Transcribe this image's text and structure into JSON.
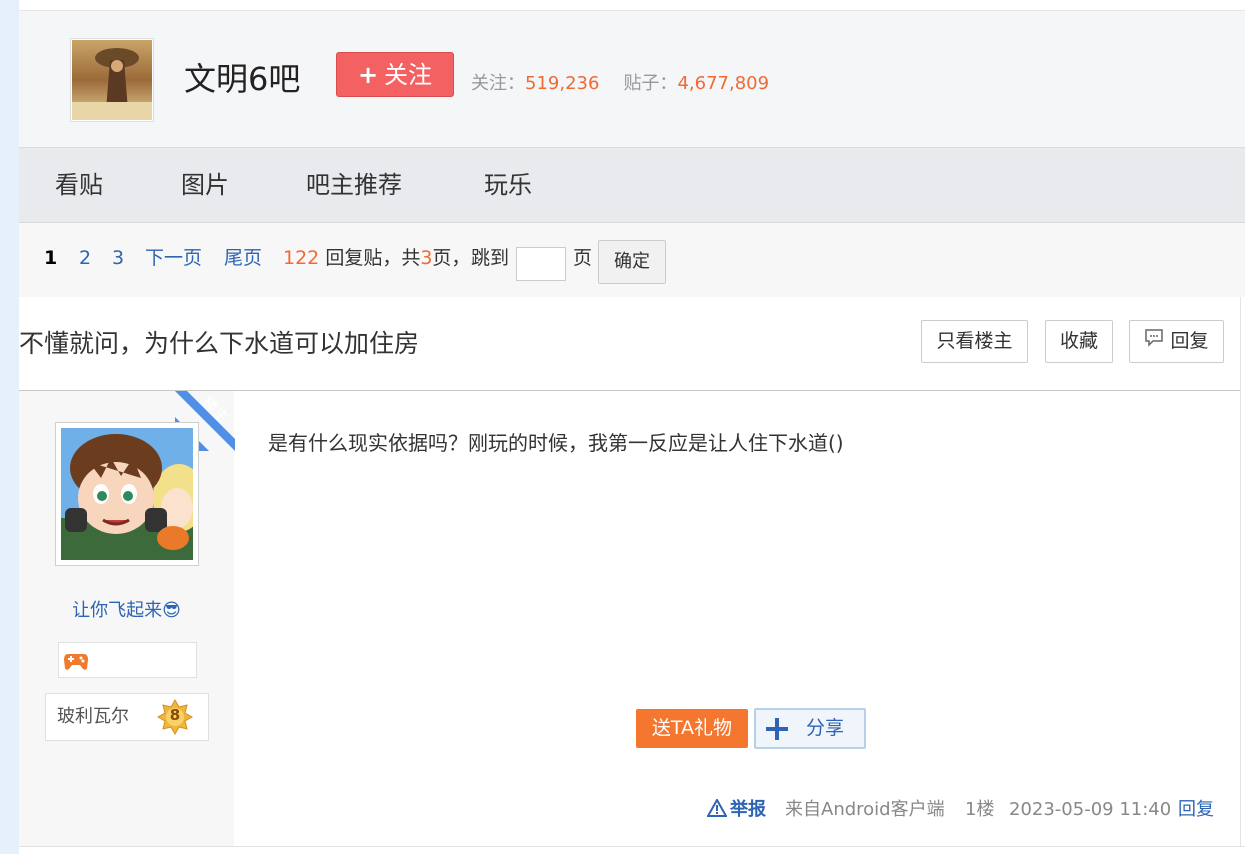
{
  "forum": {
    "name": "文明6吧",
    "follow_label": "关注",
    "follow_plus": "+",
    "followers_label": "关注：",
    "followers_count": "519,236",
    "posts_label": "贴子：",
    "posts_count": "4,677,809"
  },
  "nav": {
    "items": [
      "看贴",
      "图片",
      "吧主推荐",
      "玩乐"
    ]
  },
  "pager": {
    "current": "1",
    "pages": [
      "2",
      "3"
    ],
    "next": "下一页",
    "last": "尾页",
    "reply_count": "122",
    "reply_text": "回复贴，共",
    "total_pages": "3",
    "page_unit": "页，",
    "jump_label": "跳到",
    "jump_unit": "页",
    "confirm": "确定"
  },
  "thread": {
    "title": "不懂就问，为什么下水道可以加住房",
    "only_op": "只看楼主",
    "favorite": "收藏",
    "reply": "回复"
  },
  "post": {
    "badge": "楼主",
    "username": "让你飞起来😎",
    "level_name": "玻利瓦尔",
    "level_num": "8",
    "content": "是有什么现实依据吗？刚玩的时候，我第一反应是让人住下水道()",
    "gift_label": "送TA礼物",
    "share_label": "分享",
    "report_label": "举报",
    "client": "来自Android客户端",
    "floor": "1楼",
    "time": "2023-05-09 11:40",
    "reply_label": "回复"
  },
  "colors": {
    "accent_blue": "#2d64b3",
    "orange": "#f06a33",
    "follow_red": "#f36163",
    "gift_orange": "#f5762e"
  }
}
